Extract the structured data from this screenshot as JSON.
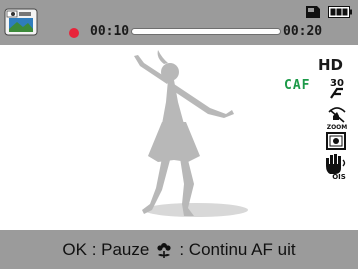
{
  "recording": {
    "elapsed": "00:10",
    "total": "00:20",
    "progress_fraction": 0.5
  },
  "status_icons": {
    "mode": "video-mode-icon",
    "storage": "memory-card-icon",
    "battery": "battery-full-icon"
  },
  "settings": {
    "resolution": "HD",
    "focus_mode": "CAF",
    "frame_rate_icon": "30fps-icon",
    "zoom_icon": "zoom-sound-off-icon",
    "metering_icon": "metering-icon",
    "ois_icon": "ois-icon"
  },
  "bottom_hint": {
    "ok_part": "OK : Pauze",
    "macro_part": ": Continu AF uit",
    "macro_icon": "macro-flower-icon"
  },
  "colors": {
    "bar_gray": "#9b9b9b",
    "rec_red": "#e8243a",
    "caf_green": "#1c9a48",
    "silhouette_gray": "#b8b8b8"
  }
}
